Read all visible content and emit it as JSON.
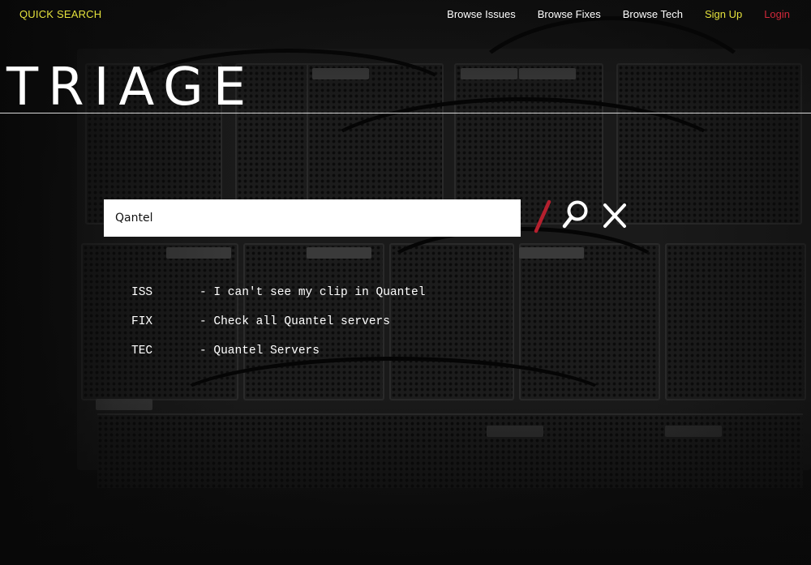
{
  "nav": {
    "brand": "QUICK SEARCH",
    "links": [
      {
        "label": "Browse Issues"
      },
      {
        "label": "Browse Fixes"
      },
      {
        "label": "Browse Tech"
      },
      {
        "label": "Sign Up"
      },
      {
        "label": "Login"
      }
    ]
  },
  "logo": "TRIAGE",
  "search": {
    "value": "Qantel",
    "search_icon": "search-icon",
    "clear_icon": "close-icon"
  },
  "results": [
    {
      "type": "ISS",
      "text": "- I can't see my clip in Quantel"
    },
    {
      "type": "FIX",
      "text": "- Check all Quantel servers"
    },
    {
      "type": "TEC",
      "text": "- Quantel Servers"
    }
  ],
  "colors": {
    "brand_yellow": "#e4e13c",
    "login_red": "#d0283a",
    "slash_red": "#b5202e",
    "text_white": "#ffffff",
    "background": "#101010"
  }
}
